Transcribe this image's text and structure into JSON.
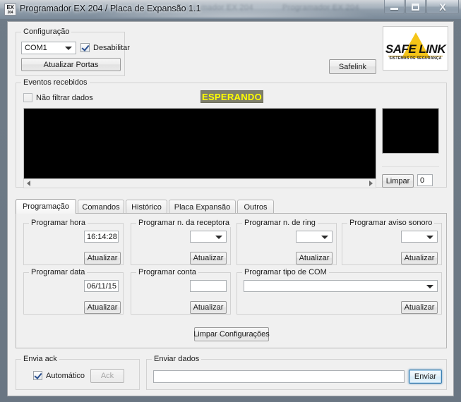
{
  "window": {
    "title": "Programador EX 204 / Placa de Expansão 1.1",
    "icon_top": "EX",
    "icon_bottom": "204",
    "ghost_text": "Programador EX 204",
    "buttons": {
      "minimize": "minimize",
      "maximize": "maximize",
      "close": "X"
    }
  },
  "config": {
    "title": "Configuração",
    "port_value": "COM1",
    "disable_label": "Desabilitar",
    "disable_checked": true,
    "refresh_ports_label": "Atualizar Portas"
  },
  "brand": {
    "button_label": "Safelink",
    "logo_main": "SAFE LINK",
    "logo_sub": "SISTEMAS DE SEGURANÇA"
  },
  "events": {
    "title": "Eventos recebidos",
    "filter_label": "Não filtrar dados",
    "filter_checked": false,
    "status": "ESPERANDO",
    "status_color": "#ffff00",
    "status_bg": "#7f7f6b",
    "log_text": "",
    "preview_text": "",
    "clear_label": "Limpar",
    "counter_value": "0"
  },
  "tabs": [
    {
      "label": "Programação",
      "active": true
    },
    {
      "label": "Comandos",
      "active": false
    },
    {
      "label": "Histórico",
      "active": false
    },
    {
      "label": "Placa Expansão",
      "active": false
    },
    {
      "label": "Outros",
      "active": false
    }
  ],
  "programming": {
    "hora": {
      "title": "Programar hora",
      "value": "16:14:28",
      "button": "Atualizar"
    },
    "receptora": {
      "title": "Programar n. da receptora",
      "value": "",
      "button": "Atualizar"
    },
    "ring": {
      "title": "Programar n. de ring",
      "value": "",
      "button": "Atualizar"
    },
    "aviso": {
      "title": "Programar aviso sonoro",
      "value": "",
      "button": "Atualizar"
    },
    "data": {
      "title": "Programar data",
      "value": "06/11/15",
      "button": "Atualizar"
    },
    "conta": {
      "title": "Programar conta",
      "value": "",
      "button": "Atualizar"
    },
    "tipocom": {
      "title": "Programar tipo de COM",
      "value": "",
      "button": "Atualizar"
    },
    "clear_config_label": "Limpar Configurações"
  },
  "ack": {
    "title": "Envia ack",
    "auto_label": "Automático",
    "auto_checked": true,
    "ack_button": "Ack",
    "ack_disabled": true
  },
  "send": {
    "title": "Enviar dados",
    "value": "",
    "button": "Enviar"
  }
}
